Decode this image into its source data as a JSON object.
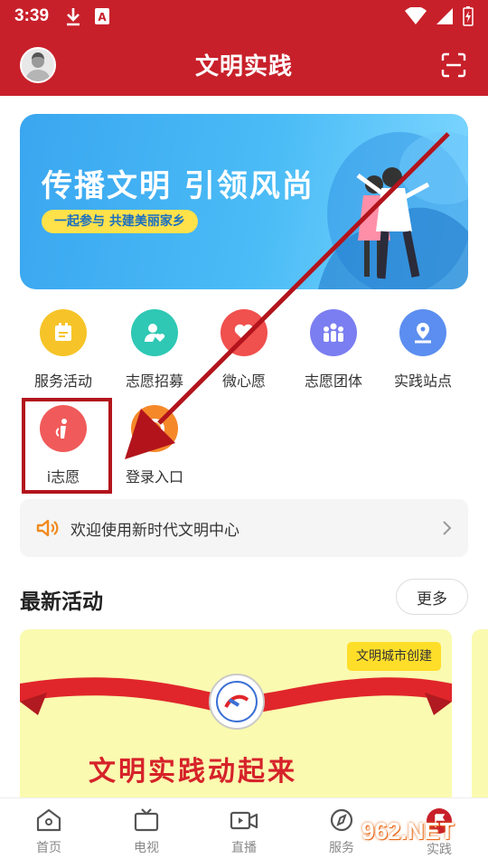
{
  "status_bar": {
    "time": "3:39"
  },
  "header": {
    "title": "文明实践"
  },
  "banner": {
    "title": "传播文明 引领风尚",
    "subtitle": "一起参与 共建美丽家乡"
  },
  "grid": {
    "items": [
      {
        "label": "服务活动",
        "icon": "calendar-icon",
        "color": "#f6c428"
      },
      {
        "label": "志愿招募",
        "icon": "user-heart-icon",
        "color": "#2ec8b4"
      },
      {
        "label": "微心愿",
        "icon": "heart-icon",
        "color": "#f0504e"
      },
      {
        "label": "志愿团体",
        "icon": "group-icon",
        "color": "#7b7ef0"
      },
      {
        "label": "实践站点",
        "icon": "location-pin-icon",
        "color": "#5b8ef0"
      },
      {
        "label": "i志愿",
        "icon": "volunteer-icon",
        "color": "#f05a5a"
      },
      {
        "label": "登录入口",
        "icon": "login-icon",
        "color": "#f5892a"
      }
    ]
  },
  "notice": {
    "text": "欢迎使用新时代文明中心"
  },
  "latest": {
    "title": "最新活动",
    "more_label": "更多",
    "card_badge": "文明城市创建",
    "card_banner_text": "文明实践动起来"
  },
  "bottom_nav": {
    "items": [
      {
        "label": "首页",
        "icon": "home-icon"
      },
      {
        "label": "电视",
        "icon": "tv-icon"
      },
      {
        "label": "直播",
        "icon": "video-icon"
      },
      {
        "label": "服务",
        "icon": "compass-icon"
      },
      {
        "label": "实践",
        "icon": "flag-icon"
      }
    ]
  },
  "watermark": "962.NET",
  "colors": {
    "primary": "#c8202a",
    "highlight": "#b3141c"
  }
}
